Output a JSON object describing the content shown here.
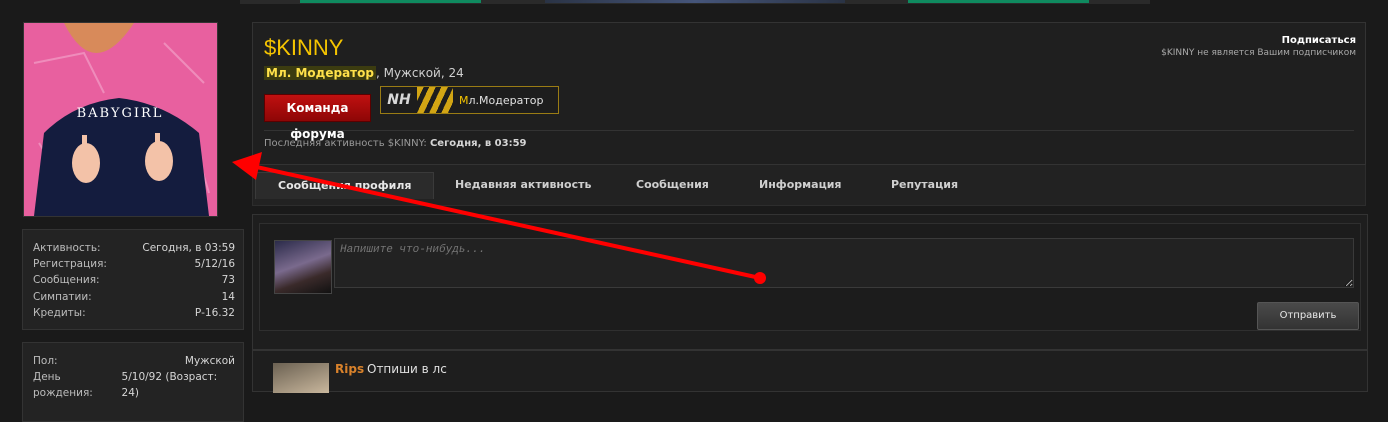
{
  "sidebar": {
    "stats": [
      {
        "label": "Активность:",
        "value": "Сегодня, в 03:59"
      },
      {
        "label": "Регистрация:",
        "value": "5/12/16"
      },
      {
        "label": "Сообщения:",
        "value": "73"
      },
      {
        "label": "Симпатии:",
        "value": "14"
      },
      {
        "label": "Кредиты:",
        "value": "Р-16.32"
      }
    ],
    "details": [
      {
        "label": "Пол:",
        "value": "Мужской"
      },
      {
        "label": "День рождения:",
        "value": "5/10/92 (Возраст: 24)"
      }
    ],
    "avatar_print": "BABYGIRL"
  },
  "profile": {
    "username": "$KINNY",
    "role": "Мл. Модератор",
    "meta": ", Мужской, 24",
    "team_badge": "Команда форума",
    "nh_badge": {
      "logo": "NH",
      "first_letter": "М",
      "rest": "л.Модератор"
    },
    "subscribe_label": "Подписаться",
    "subscribe_note": "$KINNY не является Вашим подписчиком",
    "last_activity_label": "Последняя активность $KINNY:",
    "last_activity_value": "Сегодня, в 03:59"
  },
  "tabs": [
    {
      "label": "Сообщения профиля",
      "active": true
    },
    {
      "label": "Недавняя активность",
      "active": false
    },
    {
      "label": "Сообщения",
      "active": false
    },
    {
      "label": "Информация",
      "active": false
    },
    {
      "label": "Репутация",
      "active": false
    }
  ],
  "post_form": {
    "placeholder": "Напишите что-нибудь...",
    "send_label": "Отправить"
  },
  "comment": {
    "author": "Rips",
    "text": "Отпиши в лс"
  },
  "colors": {
    "accent_gold": "#f5c400",
    "team_red": "#c01010",
    "arrow_red": "#ff0000"
  }
}
